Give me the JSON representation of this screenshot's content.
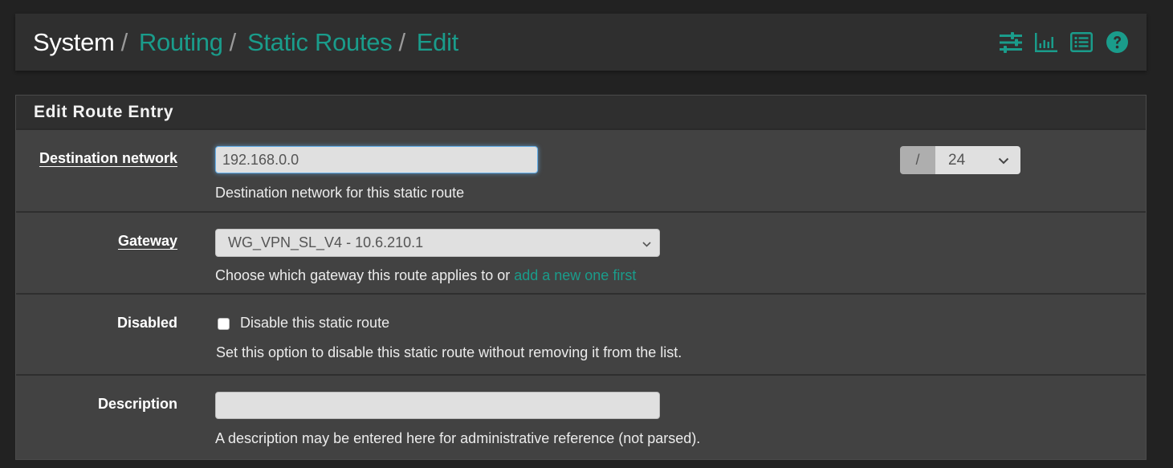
{
  "breadcrumb": {
    "root": "System",
    "items": [
      "Routing",
      "Static Routes",
      "Edit"
    ],
    "separator": "/"
  },
  "header_icons": [
    "sliders-icon",
    "bar-chart-icon",
    "list-icon",
    "help-icon"
  ],
  "accent_color": "#1a9c8b",
  "panel": {
    "title": "Edit Route Entry",
    "rows": {
      "destination": {
        "label": "Destination network",
        "value": "192.168.0.0",
        "help": "Destination network for this static route",
        "mask_separator": "/",
        "mask_value": "24"
      },
      "gateway": {
        "label": "Gateway",
        "selected": "WG_VPN_SL_V4 - 10.6.210.1",
        "help_prefix": "Choose which gateway this route applies to or ",
        "help_link": "add a new one first"
      },
      "disabled": {
        "label": "Disabled",
        "checkbox_label": "Disable this static route",
        "checked": false,
        "help": "Set this option to disable this static route without removing it from the list."
      },
      "description": {
        "label": "Description",
        "value": "",
        "help": "A description may be entered here for administrative reference (not parsed)."
      }
    }
  }
}
